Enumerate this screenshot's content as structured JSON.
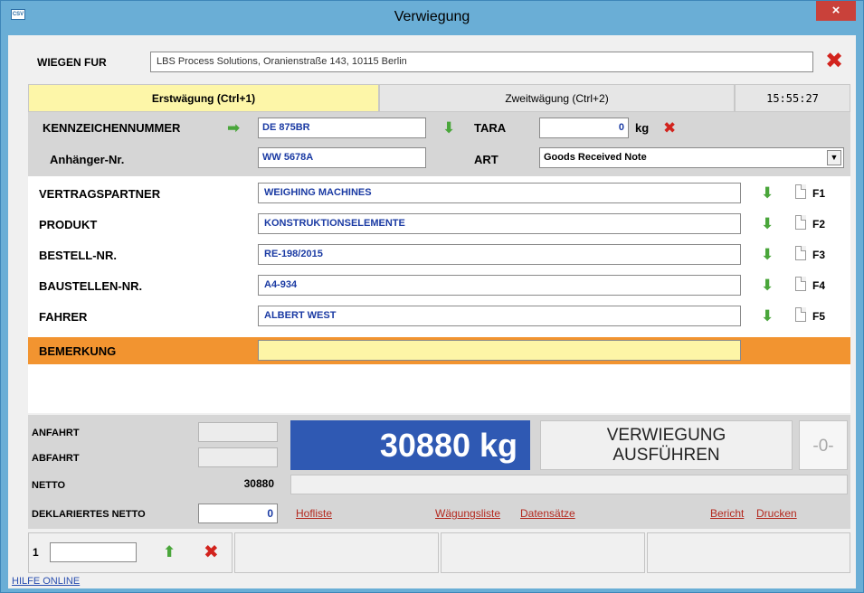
{
  "window": {
    "title": "Verwiegung",
    "icon_text": "CSV",
    "close_label": "×"
  },
  "wiegen": {
    "label": "WIEGEN FUR",
    "value": "LBS Process Solutions, Oranienstraße 143, 10115 Berlin",
    "clear_label": "✖"
  },
  "tabs": [
    {
      "label": "Erstwägung (Ctrl+1)",
      "active": true
    },
    {
      "label": "Zweitwägung (Ctrl+2)",
      "active": false
    }
  ],
  "clock": "15:55:27",
  "vehicle": {
    "kennzeichen_label": "KENNZEICHENNUMMER",
    "kennzeichen_value": "DE 875BR",
    "anhaenger_label": "Anhänger-Nr.",
    "anhaenger_value": "WW 5678A",
    "tara_label": "TARA",
    "tara_value": "0",
    "tara_unit": "kg",
    "art_label": "ART",
    "art_value": "Goods Received Note"
  },
  "fields": [
    {
      "label": "VERTRAGSPARTNER",
      "value": "WEIGHING MACHINES",
      "fkey": "F1"
    },
    {
      "label": "PRODUKT",
      "value": "KONSTRUKTIONSELEMENTE",
      "fkey": "F2"
    },
    {
      "label": "BESTELL-NR.",
      "value": "RE-198/2015",
      "fkey": "F3"
    },
    {
      "label": "BAUSTELLEN-NR.",
      "value": "A4-934",
      "fkey": "F4"
    },
    {
      "label": "FAHRER",
      "value": "ALBERT WEST",
      "fkey": "F5"
    }
  ],
  "bemerkung": {
    "label": "BEMERKUNG",
    "value": ""
  },
  "weighing": {
    "anfahrt_label": "ANFAHRT",
    "abfahrt_label": "ABFAHRT",
    "netto_label": "NETTO",
    "netto_value": "30880",
    "decl_label": "DEKLARIERTES NETTO",
    "decl_value": "0",
    "weight_display": "30880 kg",
    "execute_label_1": "VERWIEGUNG",
    "execute_label_2": "AUSFÜHREN",
    "counter": "-0-"
  },
  "links": {
    "hofliste": "Hofliste",
    "waegungsliste": "Wägungsliste",
    "datensaetze": "Datensätze",
    "bericht": "Bericht",
    "drucken": "Drucken"
  },
  "footer": {
    "number": "1",
    "help": "HILFE ONLINE"
  },
  "colors": {
    "title_bar": "#6aaed6",
    "active_tab": "#fdf6a8",
    "highlight_row": "#f29430",
    "weight_display": "#2f59b3",
    "value_text": "#1a3aa3",
    "delete_red": "#d2231d",
    "arrow_green": "#4aa63b"
  }
}
